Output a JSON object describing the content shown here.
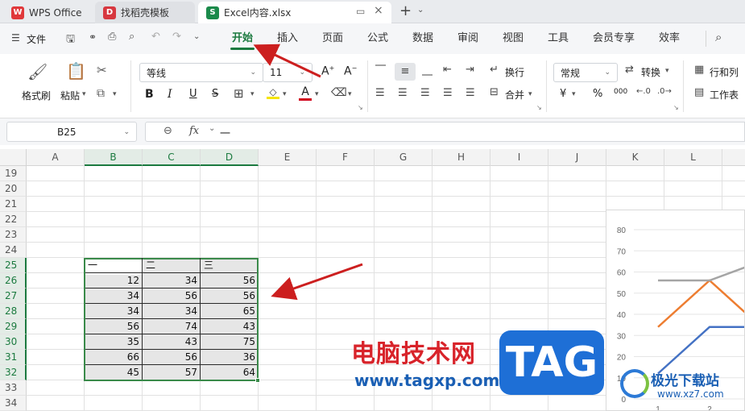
{
  "tabs": [
    {
      "label": "WPS Office",
      "icon": "wps-logo-icon",
      "color": "#e0383a"
    },
    {
      "label": "找稻壳模板",
      "icon": "docer-logo-icon",
      "color": "#d7373f"
    },
    {
      "label": "Excel内容.xlsx",
      "icon": "spreadsheet-s-icon",
      "color": "#1b8a4b",
      "icon_text": "S",
      "active": true
    }
  ],
  "menu": {
    "file_label": "文件",
    "items": [
      "开始",
      "插入",
      "页面",
      "公式",
      "数据",
      "审阅",
      "视图",
      "工具",
      "会员专享",
      "效率"
    ],
    "active": "开始"
  },
  "ribbon": {
    "format_painter": "格式刷",
    "paste": "粘贴",
    "font_name": "等线",
    "font_size": "11",
    "wrap_text": "换行",
    "merge": "合并",
    "number_format": "常规",
    "convert": "转换",
    "rows_cols": "行和列",
    "worksheet": "工作表",
    "bold": "B",
    "italic": "I",
    "underline": "U",
    "strike": "S",
    "font_color_letter": "A",
    "yen": "¥",
    "percent": "%",
    "thousands": "000",
    "font_increase": "A",
    "font_decrease": "A"
  },
  "formula_bar": {
    "name_box": "B25",
    "fx_label": "fx",
    "content": "一"
  },
  "columns": [
    "A",
    "B",
    "C",
    "D",
    "E",
    "F",
    "G",
    "H",
    "I",
    "J",
    "K",
    "L"
  ],
  "selected_columns": [
    "B",
    "C",
    "D"
  ],
  "rows": [
    "19",
    "20",
    "21",
    "22",
    "23",
    "24",
    "25",
    "26",
    "27",
    "28",
    "29",
    "30",
    "31",
    "32",
    "33",
    "34"
  ],
  "selected_rows": [
    "25",
    "26",
    "27",
    "28",
    "29",
    "30",
    "31",
    "32"
  ],
  "table": {
    "headers": [
      "一",
      "二",
      "三"
    ],
    "data": [
      [
        12,
        34,
        56
      ],
      [
        34,
        56,
        56
      ],
      [
        34,
        34,
        65
      ],
      [
        56,
        74,
        43
      ],
      [
        35,
        43,
        75
      ],
      [
        66,
        56,
        36
      ],
      [
        45,
        57,
        64
      ]
    ]
  },
  "chart_data": {
    "type": "line",
    "y_ticks": [
      "80",
      "70",
      "60",
      "50",
      "40",
      "30",
      "20",
      "10",
      "0"
    ],
    "x_ticks": [
      "1",
      "2"
    ],
    "ylim": [
      0,
      80
    ],
    "series": [
      {
        "color": "#4472c4",
        "values": [
          12,
          34,
          34
        ]
      },
      {
        "color": "#ed7d31",
        "values": [
          34,
          56,
          34
        ]
      },
      {
        "color": "#a5a5a5",
        "values": [
          56,
          56,
          65
        ]
      }
    ]
  },
  "watermark": {
    "site_name": "电脑技术网",
    "tag": "TAG",
    "url": "www.tagxp.com",
    "corner_brand": "极光下载站",
    "corner_url": "www.xz7.com"
  }
}
